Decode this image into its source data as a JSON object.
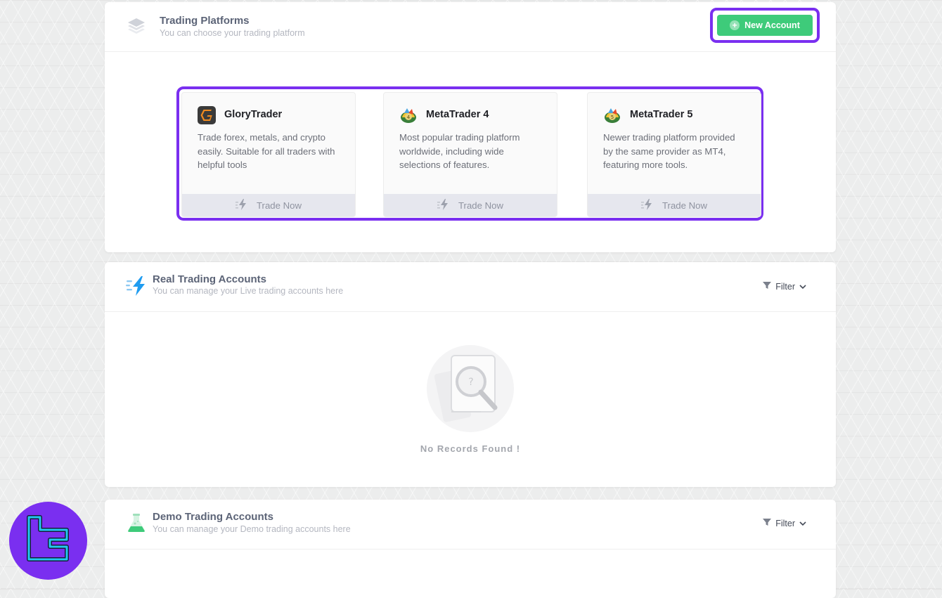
{
  "platforms": {
    "title": "Trading Platforms",
    "subtitle": "You can choose your trading platform",
    "new_account_label": "New Account",
    "cards": [
      {
        "name": "GloryTrader",
        "description": "Trade forex, metals, and crypto easily. Suitable for all traders with helpful tools",
        "action": "Trade Now"
      },
      {
        "name": "MetaTrader 4",
        "description": "Most popular trading platform worldwide, including wide selections of features.",
        "action": "Trade Now"
      },
      {
        "name": "MetaTrader 5",
        "description": "Newer trading platform provided by the same provider as MT4, featuring more tools.",
        "action": "Trade Now"
      }
    ]
  },
  "real_accounts": {
    "title": "Real Trading Accounts",
    "subtitle": "You can manage your Live trading accounts here",
    "filter_label": "Filter",
    "empty_text": "No Records Found !"
  },
  "demo_accounts": {
    "title": "Demo Trading Accounts",
    "subtitle": "You can manage your Demo trading accounts here",
    "filter_label": "Filter"
  },
  "colors": {
    "accent_outline": "#7a2ff0",
    "new_account_green": "#3ecb7a",
    "lightning_blue": "#1f9cf0",
    "flask_green": "#3ecb7a"
  },
  "icons": {
    "platforms": "layers-icon",
    "real": "lightning-icon",
    "demo": "flask-icon",
    "filter": "filter-icon",
    "chevron": "chevron-down-icon"
  }
}
